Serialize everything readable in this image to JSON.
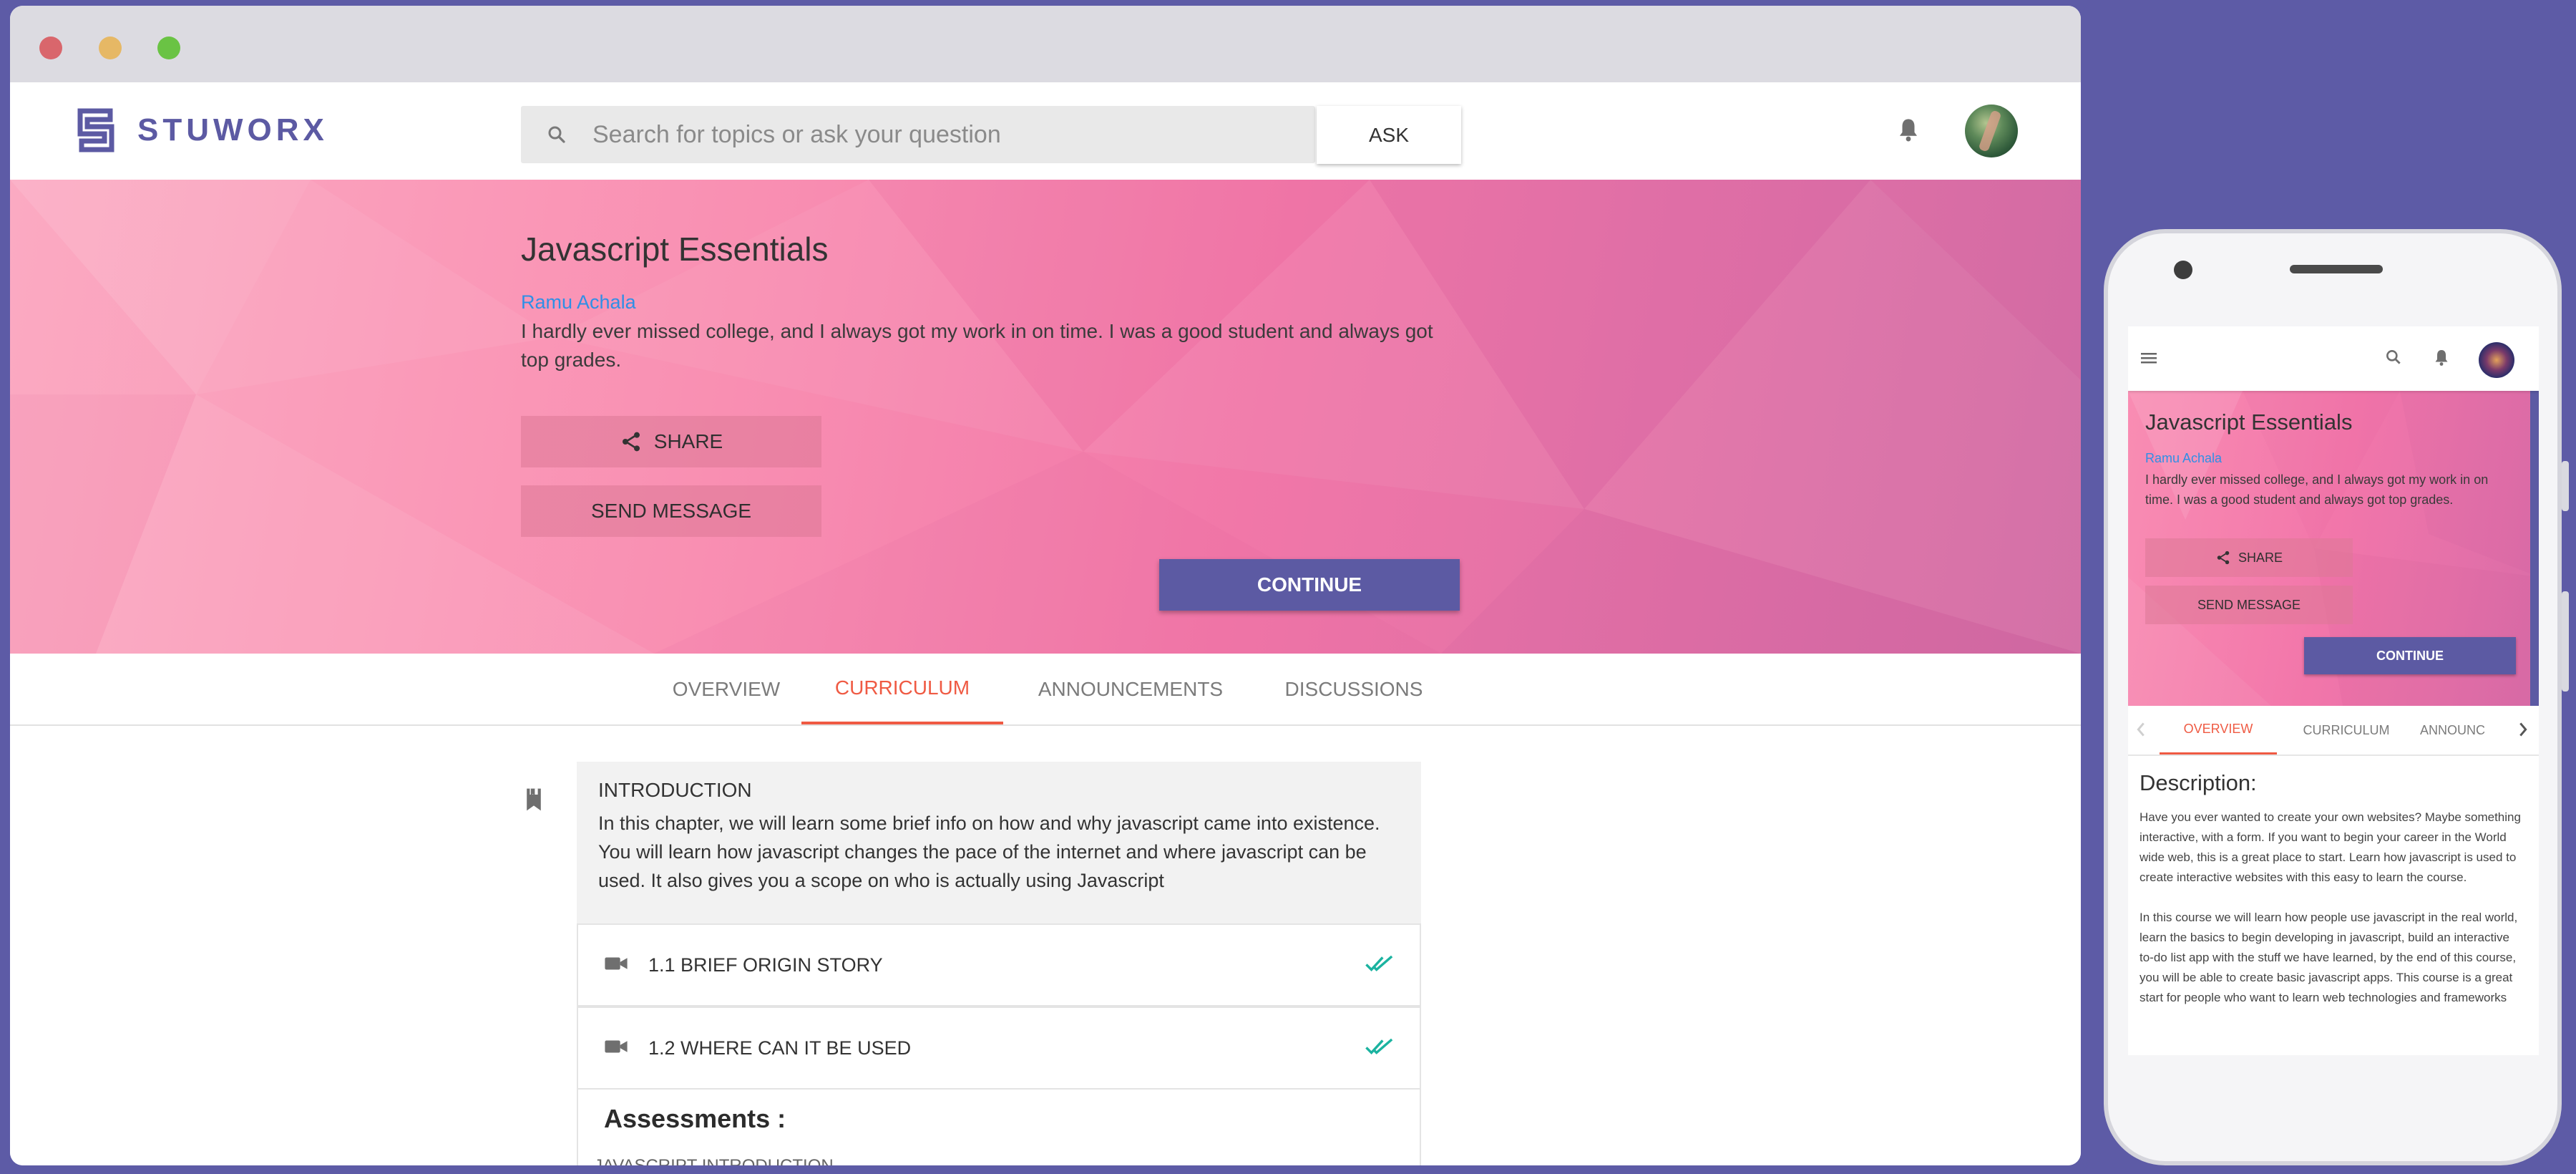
{
  "desktop": {
    "brand": "STUWORX",
    "search": {
      "placeholder": "Search for topics or ask your question",
      "ask_label": "ASK"
    },
    "course": {
      "title": "Javascript Essentials",
      "author": "Ramu Achala",
      "description": "I hardly ever missed college, and I always got my work in on time. I was a good student and always got top grades."
    },
    "actions": {
      "share": "SHARE",
      "send_message": "SEND MESSAGE",
      "continue": "CONTINUE"
    },
    "tabs": [
      {
        "label": "OVERVIEW",
        "active": false
      },
      {
        "label": "CURRICULUM",
        "active": true
      },
      {
        "label": "ANNOUNCEMENTS",
        "active": false
      },
      {
        "label": "DISCUSSIONS",
        "active": false
      }
    ],
    "curriculum": {
      "chapter_title": "INTRODUCTION",
      "chapter_text": "In this chapter, we will learn some brief info on how and why javascript came into existence. You will learn how javascript changes the pace of the internet and where javascript can be used. It also gives you a scope on who is actually using Javascript",
      "lessons": [
        {
          "title": "1.1 BRIEF ORIGIN STORY",
          "icon": "video-camera-icon",
          "status": "completed"
        },
        {
          "title": "1.2 WHERE CAN IT BE USED",
          "icon": "video-camera-icon",
          "status": "completed"
        }
      ],
      "assessments_title": "Assessments :",
      "assessment_first_item": "JAVASCRIPT INTRODUCTION"
    }
  },
  "mobile": {
    "course": {
      "title": "Javascript Essentials",
      "author": "Ramu Achala",
      "description": "I hardly ever missed college, and I always got my work in on time. I was a good student and always got top grades."
    },
    "actions": {
      "share": "SHARE",
      "send_message": "SEND MESSAGE",
      "continue": "CONTINUE"
    },
    "tabs": [
      {
        "label": "OVERVIEW",
        "active": true
      },
      {
        "label": "CURRICULUM",
        "active": false
      },
      {
        "label": "ANNOUNC",
        "active": false
      }
    ],
    "description_title": "Description:",
    "description_p1": "Have you ever wanted to create your own websites? Maybe something interactive, with a form. If you want to begin your career in the World wide web, this is a great place to start. Learn how javascript is used to create interactive websites with this easy to learn the course.",
    "description_p2": "In this course we will learn how people use javascript in the real world, learn the basics to begin developing in javascript, build an interactive to-do list app with the stuff we have learned, by the end of this course, you will be able to create basic javascript apps. This course is a great start for people who want to learn web technologies and frameworks"
  },
  "colors": {
    "background": "#5d5ba6",
    "brand": "#5c5aa3",
    "accent_tab": "#ef5a43",
    "link": "#2f8fe6",
    "check": "#1bb3a0",
    "hero_pink": "#f98fb2"
  }
}
